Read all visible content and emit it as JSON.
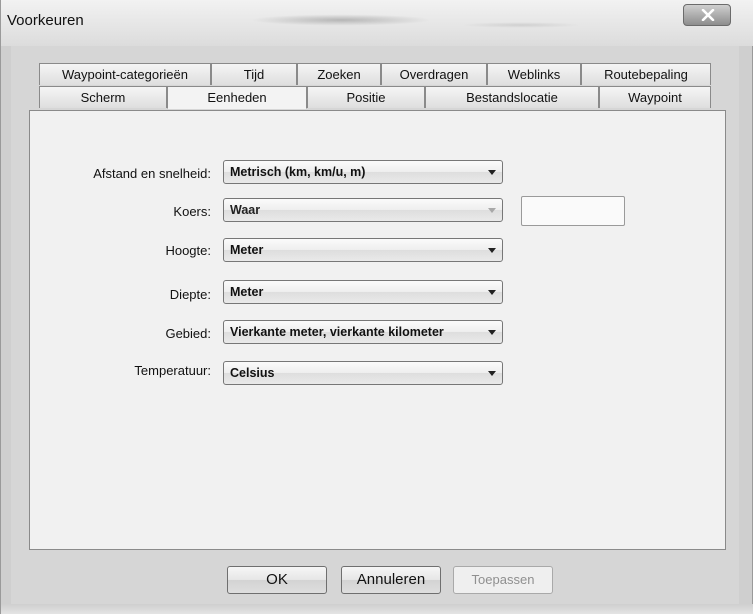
{
  "window": {
    "title": "Voorkeuren"
  },
  "tabs": {
    "row1": [
      "Waypoint-categorieën",
      "Tijd",
      "Zoeken",
      "Overdragen",
      "Weblinks",
      "Routebepaling"
    ],
    "row2": [
      "Scherm",
      "Eenheden",
      "Positie",
      "Bestandslocatie",
      "Waypoint"
    ],
    "active": "Eenheden"
  },
  "units": {
    "distance": {
      "label": "Afstand en snelheid:",
      "value": "Metrisch (km, km/u, m)"
    },
    "heading": {
      "label": "Koers:",
      "value": "Waar"
    },
    "altitude": {
      "label": "Hoogte:",
      "value": "Meter"
    },
    "depth": {
      "label": "Diepte:",
      "value": "Meter"
    },
    "area": {
      "label": "Gebied:",
      "value": "Vierkante meter, vierkante kilometer"
    },
    "temperature": {
      "label": "Temperatuur:",
      "value": "Celsius"
    }
  },
  "buttons": {
    "ok": "OK",
    "cancel": "Annuleren",
    "apply": "Toepassen"
  },
  "icons": {
    "close": "close-icon",
    "dropdown": "chevron-down-icon"
  }
}
